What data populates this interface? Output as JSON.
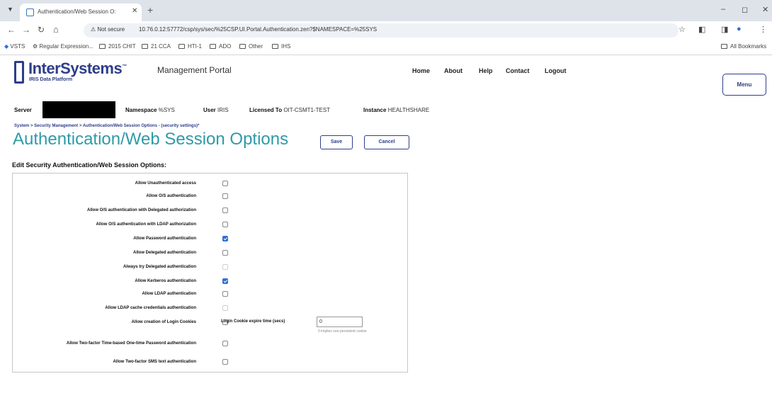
{
  "browser": {
    "tab_title": "Authentication/Web Session O:",
    "tab_close": "✕",
    "new_tab": "+",
    "not_secure": "⚠ Not secure",
    "url": "10.76.0.12:57772/csp/sys/sec/%25CSP.UI.Portal.Authentication.zen?$NAMESPACE=%25SYS",
    "bookmarks": [
      "VSTS",
      "Regular Expression...",
      "2015 CHIT",
      "21 CCA",
      "HTI-1",
      "ADO",
      "Other",
      "IHS"
    ],
    "all_bookmarks": "All Bookmarks"
  },
  "header": {
    "logo": "InterSystems",
    "logo_tm": "™",
    "logo_sub": "IRIS Data Platform",
    "portal_title": "Management Portal",
    "nav": [
      "Home",
      "About",
      "Help",
      "Contact",
      "Logout"
    ],
    "menu_label": "Menu"
  },
  "infobar": {
    "server_label": "Server",
    "namespace_label": "Namespace",
    "namespace_value": "%SYS",
    "user_label": "User",
    "user_value": "IRIS",
    "licensed_label": "Licensed To",
    "licensed_value": "OIT-CSMT1-TEST",
    "instance_label": "Instance",
    "instance_value": "HEALTHSHARE"
  },
  "breadcrumb": "System > Security Management > Authentication/Web Session Options - (security settings)*",
  "page_title": "Authentication/Web Session Options",
  "buttons": {
    "save": "Save",
    "cancel": "Cancel"
  },
  "section_title": "Edit Security Authentication/Web Session Options:",
  "options": [
    {
      "label": "Allow Unauthenticated access",
      "checked": false,
      "disabled": false
    },
    {
      "label": "Allow O/S authentication",
      "checked": false,
      "disabled": false
    },
    {
      "label": "Allow O/S authentication with Delegated authorization",
      "checked": false,
      "disabled": false
    },
    {
      "label": "Allow O/S authentication with LDAP authorization",
      "checked": false,
      "disabled": false
    },
    {
      "label": "Allow Password authentication",
      "checked": true,
      "disabled": false
    },
    {
      "label": "Allow Delegated authentication",
      "checked": false,
      "disabled": false
    },
    {
      "label": "Always try Delegated authentication",
      "checked": false,
      "disabled": true
    },
    {
      "label": "Allow Kerberos authentication",
      "checked": true,
      "disabled": false
    },
    {
      "label": "Allow LDAP authentication",
      "checked": false,
      "disabled": false
    },
    {
      "label": "Allow LDAP cache credentials authentication",
      "checked": false,
      "disabled": true
    },
    {
      "label": "Allow creation of Login Cookies",
      "checked": false,
      "disabled": false
    },
    {
      "label": "Allow Two-factor Time-based One-time Password authentication",
      "checked": false,
      "disabled": false
    },
    {
      "label": "Allow Two-factor SMS text authentication",
      "checked": false,
      "disabled": false
    }
  ],
  "cookie": {
    "label": "Login Cookie expire time (secs)",
    "value": "0",
    "hint": "0 implies non-persistent cookie"
  }
}
